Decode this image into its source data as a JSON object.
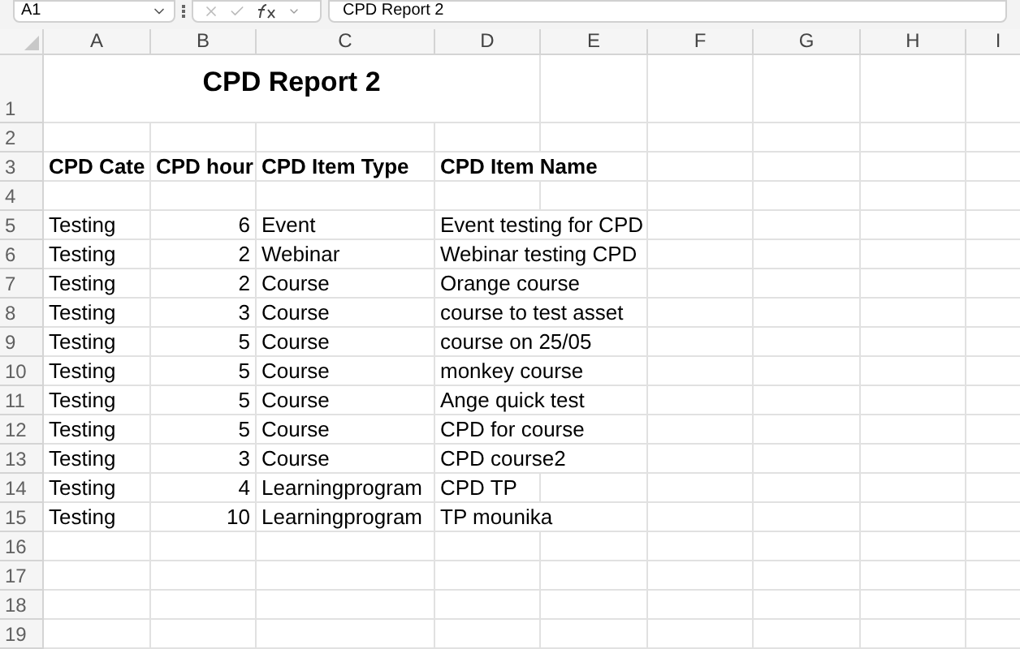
{
  "formula_bar": {
    "name_box": "A1",
    "formula": "CPD Report 2"
  },
  "columns": [
    "A",
    "B",
    "C",
    "D",
    "E",
    "F",
    "G",
    "H",
    "I"
  ],
  "rows": [
    {
      "number": "1",
      "kind": "title",
      "cells": [
        "CPD Report 2"
      ]
    },
    {
      "number": "2",
      "kind": "empty"
    },
    {
      "number": "3",
      "kind": "header",
      "cells": [
        "CPD Cate",
        "CPD hour",
        "CPD Item Type",
        "CPD Item Name"
      ]
    },
    {
      "number": "4",
      "kind": "empty"
    },
    {
      "number": "5",
      "kind": "data",
      "cells": [
        "Testing",
        "6",
        "Event",
        "Event testing for CPD"
      ]
    },
    {
      "number": "6",
      "kind": "data",
      "cells": [
        "Testing",
        "2",
        "Webinar",
        "Webinar testing CPD"
      ]
    },
    {
      "number": "7",
      "kind": "data",
      "cells": [
        "Testing",
        "2",
        "Course",
        "Orange course"
      ]
    },
    {
      "number": "8",
      "kind": "data",
      "cells": [
        "Testing",
        "3",
        "Course",
        "course to test asset"
      ]
    },
    {
      "number": "9",
      "kind": "data",
      "cells": [
        "Testing",
        "5",
        "Course",
        "course on 25/05"
      ]
    },
    {
      "number": "10",
      "kind": "data",
      "cells": [
        "Testing",
        "5",
        "Course",
        "monkey course"
      ]
    },
    {
      "number": "11",
      "kind": "data",
      "cells": [
        "Testing",
        "5",
        "Course",
        "Ange quick test"
      ]
    },
    {
      "number": "12",
      "kind": "data",
      "cells": [
        "Testing",
        "5",
        "Course",
        "CPD for course"
      ]
    },
    {
      "number": "13",
      "kind": "data",
      "cells": [
        "Testing",
        "3",
        "Course",
        "CPD course2"
      ]
    },
    {
      "number": "14",
      "kind": "data",
      "cells": [
        "Testing",
        "4",
        "Learningprogram",
        "CPD TP"
      ]
    },
    {
      "number": "15",
      "kind": "data",
      "cells": [
        "Testing",
        "10",
        "Learningprogram",
        "TP mounika"
      ]
    },
    {
      "number": "16",
      "kind": "empty"
    },
    {
      "number": "17",
      "kind": "empty"
    },
    {
      "number": "18",
      "kind": "empty"
    },
    {
      "number": "19",
      "kind": "empty"
    }
  ]
}
